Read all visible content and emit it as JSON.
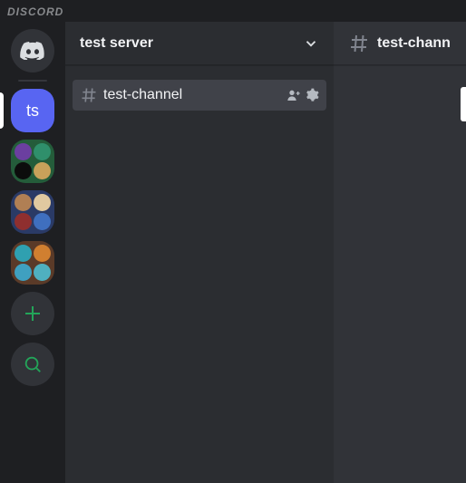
{
  "brand": "DISCORD",
  "server": {
    "name": "test server",
    "abbrev": "ts"
  },
  "channels": [
    {
      "name": "test-channel",
      "selected": true
    }
  ],
  "main": {
    "channel_title": "test-chann"
  },
  "rail": {
    "folders": [
      {
        "bg": "#245c3a",
        "dots": [
          "#6b3fa0",
          "#2f8f6b",
          "#0c0c0c",
          "#c9a15a"
        ]
      },
      {
        "bg": "#2a3a66",
        "dots": [
          "#b07f54",
          "#e0c9a0",
          "#8f2f2f",
          "#3f6fbf"
        ]
      },
      {
        "bg": "#5a3a28",
        "dots": [
          "#2fa0b0",
          "#d07f30",
          "#3fa0c0",
          "#4fb0c0"
        ]
      }
    ]
  },
  "icons": {
    "discord": "discord-logo",
    "chevron_down": "chevron-down",
    "hash": "hash",
    "invite": "person-plus",
    "gear": "gear",
    "plus": "plus",
    "explore": "compass"
  }
}
